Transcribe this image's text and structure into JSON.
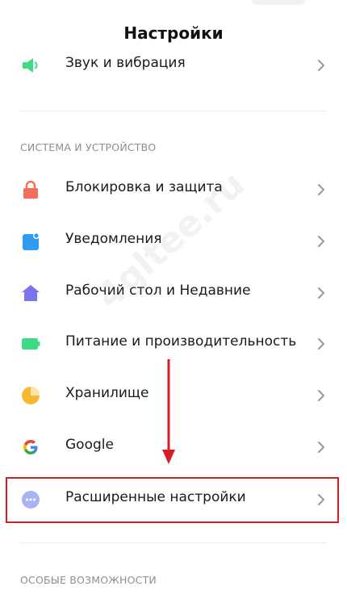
{
  "header": {
    "title": "Настройки"
  },
  "items": [
    {
      "label": "Звук и вибрация",
      "icon": "speaker-icon",
      "color": "#3ddc84"
    },
    {
      "label": "Блокировка и защита",
      "icon": "lock-icon",
      "color": "#f36f5c"
    },
    {
      "label": "Уведомления",
      "icon": "notification-icon",
      "color": "#2f9bf3"
    },
    {
      "label": "Рабочий стол и Недавние",
      "icon": "home-icon",
      "color": "#7b74f0"
    },
    {
      "label": "Питание и производительность",
      "icon": "battery-icon",
      "color": "#3ddc84"
    },
    {
      "label": "Хранилище",
      "icon": "pie-chart-icon",
      "color": "#f7b731"
    },
    {
      "label": "Google",
      "icon": "google-icon",
      "color": "#4285f4"
    },
    {
      "label": "Расширенные настройки",
      "icon": "more-dots-icon",
      "color": "#a9b2f2"
    }
  ],
  "sections": {
    "system": "СИСТЕМА И УСТРОЙСТВО",
    "accessibility": "ОСОБЫЕ ВОЗМОЖНОСТИ"
  },
  "watermark": "4gltee.ru",
  "colors": {
    "highlight": "#d81b24",
    "chevron": "#9a9a9a"
  }
}
